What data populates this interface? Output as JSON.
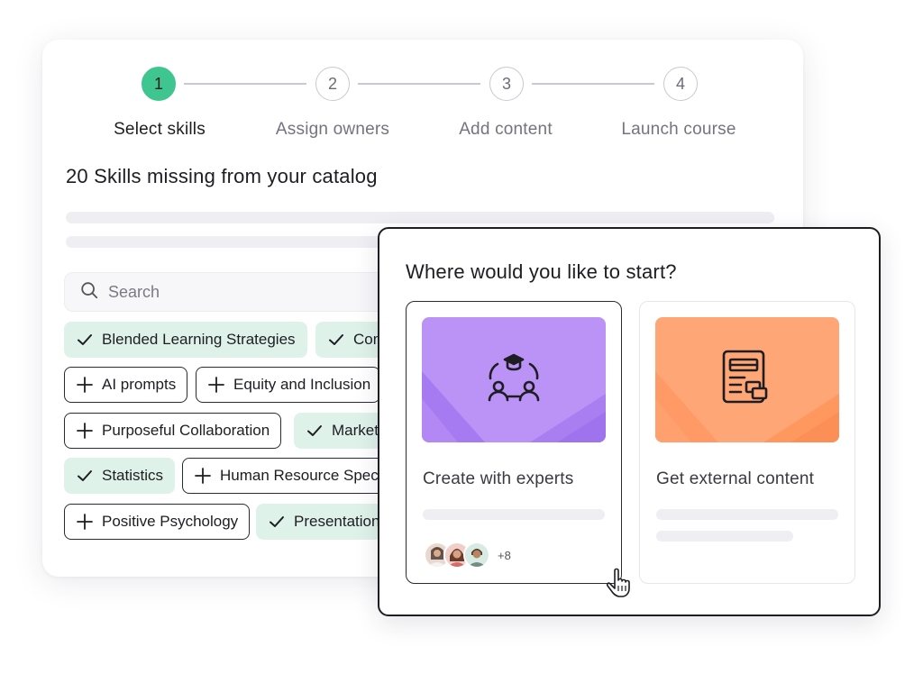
{
  "stepper": {
    "steps": [
      {
        "number": "1",
        "label": "Select skills",
        "active": true
      },
      {
        "number": "2",
        "label": "Assign owners",
        "active": false
      },
      {
        "number": "3",
        "label": "Add content",
        "active": false
      },
      {
        "number": "4",
        "label": "Launch course",
        "active": false
      }
    ]
  },
  "catalog": {
    "title": "20 Skills missing from your catalog",
    "search": {
      "placeholder": "Search",
      "value": ""
    },
    "skills": [
      {
        "label": "Blended Learning Strategies",
        "selected": true
      },
      {
        "label": "Com",
        "selected": true
      },
      {
        "label": "AI prompts",
        "selected": false
      },
      {
        "label": "Equity and Inclusion",
        "selected": false
      },
      {
        "label": "Purposeful Collaboration",
        "selected": false
      },
      {
        "label": "Market",
        "selected": true
      },
      {
        "label": "Statistics",
        "selected": true
      },
      {
        "label": "Human Resource Speci",
        "selected": false
      },
      {
        "label": "Positive Psychology",
        "selected": false
      },
      {
        "label": "Presentation",
        "selected": true
      }
    ]
  },
  "dialog": {
    "title": "Where would you like to start?",
    "options": [
      {
        "label": "Create with experts",
        "icon": "expert-group-icon",
        "color": "#b98ef7",
        "selected": true,
        "extra_count": "+8"
      },
      {
        "label": "Get external content",
        "icon": "external-content-icon",
        "color": "#ffa676",
        "selected": false
      }
    ]
  },
  "colors": {
    "accent_green": "#3fc58f",
    "chip_selected_bg": "#dff2ea",
    "border_dark": "#1d1d22"
  }
}
